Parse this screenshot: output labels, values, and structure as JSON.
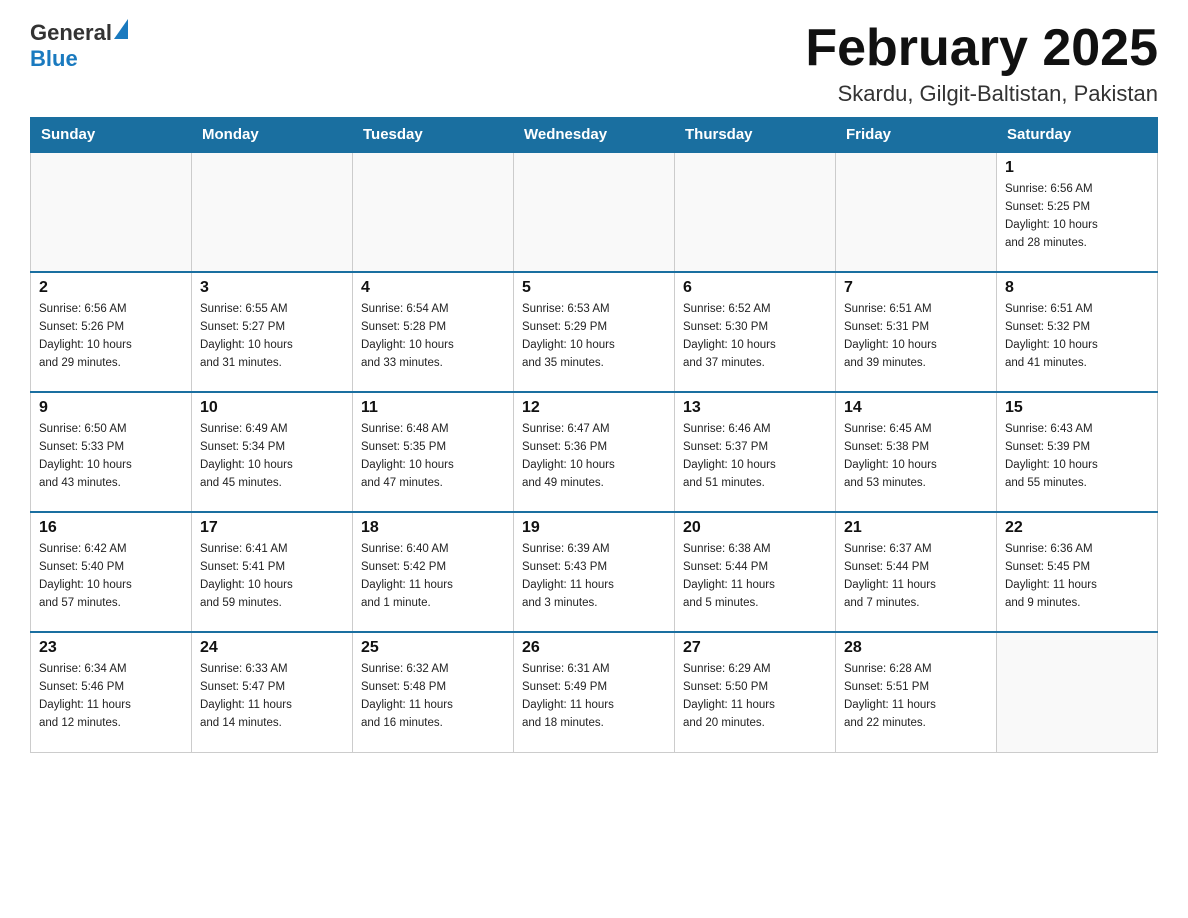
{
  "logo": {
    "general": "General",
    "blue": "Blue"
  },
  "title": "February 2025",
  "subtitle": "Skardu, Gilgit-Baltistan, Pakistan",
  "weekdays": [
    "Sunday",
    "Monday",
    "Tuesday",
    "Wednesday",
    "Thursday",
    "Friday",
    "Saturday"
  ],
  "weeks": [
    [
      {
        "day": "",
        "info": ""
      },
      {
        "day": "",
        "info": ""
      },
      {
        "day": "",
        "info": ""
      },
      {
        "day": "",
        "info": ""
      },
      {
        "day": "",
        "info": ""
      },
      {
        "day": "",
        "info": ""
      },
      {
        "day": "1",
        "info": "Sunrise: 6:56 AM\nSunset: 5:25 PM\nDaylight: 10 hours\nand 28 minutes."
      }
    ],
    [
      {
        "day": "2",
        "info": "Sunrise: 6:56 AM\nSunset: 5:26 PM\nDaylight: 10 hours\nand 29 minutes."
      },
      {
        "day": "3",
        "info": "Sunrise: 6:55 AM\nSunset: 5:27 PM\nDaylight: 10 hours\nand 31 minutes."
      },
      {
        "day": "4",
        "info": "Sunrise: 6:54 AM\nSunset: 5:28 PM\nDaylight: 10 hours\nand 33 minutes."
      },
      {
        "day": "5",
        "info": "Sunrise: 6:53 AM\nSunset: 5:29 PM\nDaylight: 10 hours\nand 35 minutes."
      },
      {
        "day": "6",
        "info": "Sunrise: 6:52 AM\nSunset: 5:30 PM\nDaylight: 10 hours\nand 37 minutes."
      },
      {
        "day": "7",
        "info": "Sunrise: 6:51 AM\nSunset: 5:31 PM\nDaylight: 10 hours\nand 39 minutes."
      },
      {
        "day": "8",
        "info": "Sunrise: 6:51 AM\nSunset: 5:32 PM\nDaylight: 10 hours\nand 41 minutes."
      }
    ],
    [
      {
        "day": "9",
        "info": "Sunrise: 6:50 AM\nSunset: 5:33 PM\nDaylight: 10 hours\nand 43 minutes."
      },
      {
        "day": "10",
        "info": "Sunrise: 6:49 AM\nSunset: 5:34 PM\nDaylight: 10 hours\nand 45 minutes."
      },
      {
        "day": "11",
        "info": "Sunrise: 6:48 AM\nSunset: 5:35 PM\nDaylight: 10 hours\nand 47 minutes."
      },
      {
        "day": "12",
        "info": "Sunrise: 6:47 AM\nSunset: 5:36 PM\nDaylight: 10 hours\nand 49 minutes."
      },
      {
        "day": "13",
        "info": "Sunrise: 6:46 AM\nSunset: 5:37 PM\nDaylight: 10 hours\nand 51 minutes."
      },
      {
        "day": "14",
        "info": "Sunrise: 6:45 AM\nSunset: 5:38 PM\nDaylight: 10 hours\nand 53 minutes."
      },
      {
        "day": "15",
        "info": "Sunrise: 6:43 AM\nSunset: 5:39 PM\nDaylight: 10 hours\nand 55 minutes."
      }
    ],
    [
      {
        "day": "16",
        "info": "Sunrise: 6:42 AM\nSunset: 5:40 PM\nDaylight: 10 hours\nand 57 minutes."
      },
      {
        "day": "17",
        "info": "Sunrise: 6:41 AM\nSunset: 5:41 PM\nDaylight: 10 hours\nand 59 minutes."
      },
      {
        "day": "18",
        "info": "Sunrise: 6:40 AM\nSunset: 5:42 PM\nDaylight: 11 hours\nand 1 minute."
      },
      {
        "day": "19",
        "info": "Sunrise: 6:39 AM\nSunset: 5:43 PM\nDaylight: 11 hours\nand 3 minutes."
      },
      {
        "day": "20",
        "info": "Sunrise: 6:38 AM\nSunset: 5:44 PM\nDaylight: 11 hours\nand 5 minutes."
      },
      {
        "day": "21",
        "info": "Sunrise: 6:37 AM\nSunset: 5:44 PM\nDaylight: 11 hours\nand 7 minutes."
      },
      {
        "day": "22",
        "info": "Sunrise: 6:36 AM\nSunset: 5:45 PM\nDaylight: 11 hours\nand 9 minutes."
      }
    ],
    [
      {
        "day": "23",
        "info": "Sunrise: 6:34 AM\nSunset: 5:46 PM\nDaylight: 11 hours\nand 12 minutes."
      },
      {
        "day": "24",
        "info": "Sunrise: 6:33 AM\nSunset: 5:47 PM\nDaylight: 11 hours\nand 14 minutes."
      },
      {
        "day": "25",
        "info": "Sunrise: 6:32 AM\nSunset: 5:48 PM\nDaylight: 11 hours\nand 16 minutes."
      },
      {
        "day": "26",
        "info": "Sunrise: 6:31 AM\nSunset: 5:49 PM\nDaylight: 11 hours\nand 18 minutes."
      },
      {
        "day": "27",
        "info": "Sunrise: 6:29 AM\nSunset: 5:50 PM\nDaylight: 11 hours\nand 20 minutes."
      },
      {
        "day": "28",
        "info": "Sunrise: 6:28 AM\nSunset: 5:51 PM\nDaylight: 11 hours\nand 22 minutes."
      },
      {
        "day": "",
        "info": ""
      }
    ]
  ]
}
